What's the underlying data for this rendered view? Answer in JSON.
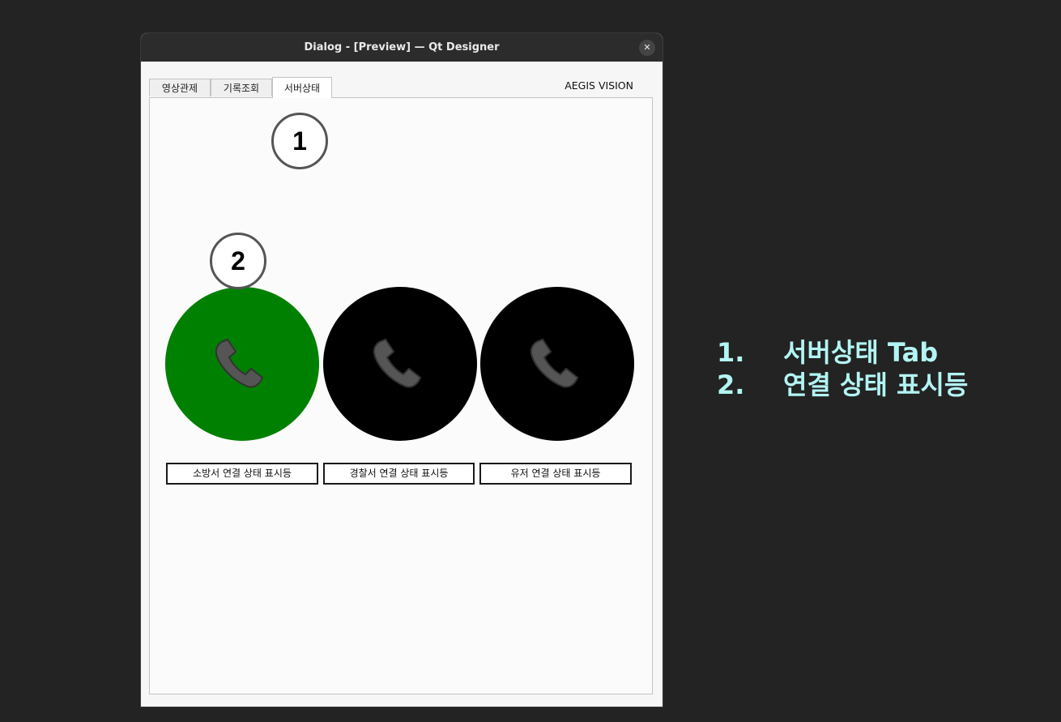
{
  "window": {
    "title": "Dialog - [Preview] — Qt Designer",
    "close_glyph": "✕"
  },
  "tabs": [
    {
      "label": "영상관제"
    },
    {
      "label": "기록조회"
    },
    {
      "label": "서버상태",
      "active": true
    }
  ],
  "brand": "AEGIS VISION",
  "callouts": [
    "1",
    "2"
  ],
  "lamps": [
    {
      "label": "소방서 연결 상태 표시등",
      "color": "#008000",
      "icon": "phone-icon"
    },
    {
      "label": "경찰서 연결 상태 표시등",
      "color": "#000000",
      "icon": "phone-icon"
    },
    {
      "label": "유저 연결 상태 표시등",
      "color": "#000000",
      "icon": "phone-icon"
    }
  ],
  "legend": [
    {
      "num": "1.",
      "text": "서버상태 Tab"
    },
    {
      "num": "2.",
      "text": "연결 상태 표시등"
    }
  ],
  "colors": {
    "background": "#222322",
    "titlebar": "#2c2c2c",
    "legend_text": "#b3f4f4",
    "lamp_on": "#008000",
    "lamp_off": "#000000"
  }
}
